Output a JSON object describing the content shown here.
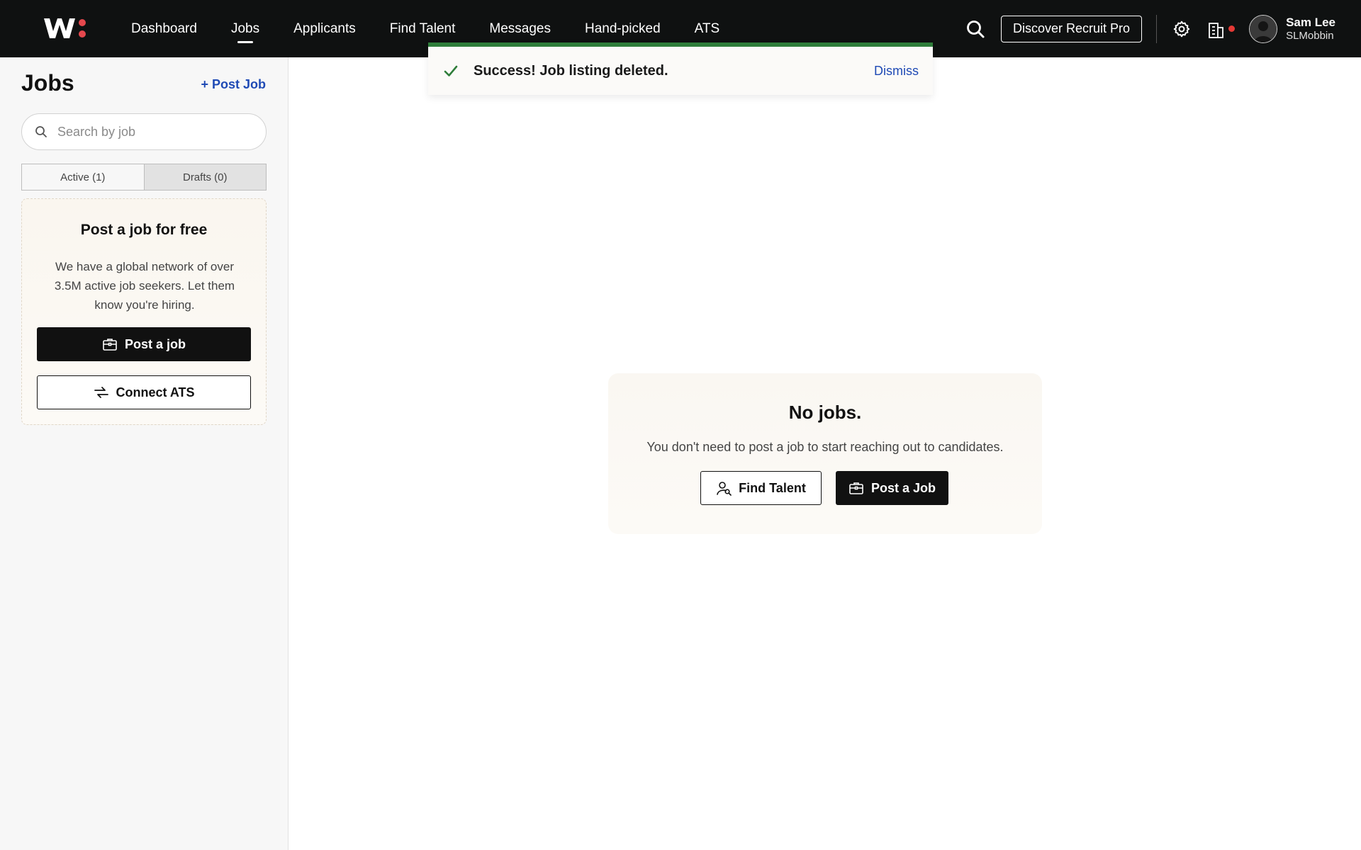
{
  "topbar": {
    "nav": [
      {
        "label": "Dashboard"
      },
      {
        "label": "Jobs",
        "active": true
      },
      {
        "label": "Applicants"
      },
      {
        "label": "Find Talent"
      },
      {
        "label": "Messages"
      },
      {
        "label": "Hand-picked"
      },
      {
        "label": "ATS"
      }
    ],
    "pro_button": "Discover Recruit Pro",
    "user": {
      "name": "Sam Lee",
      "handle": "SLMobbin"
    },
    "notification_color": "#e53935"
  },
  "toast": {
    "message": "Success! Job listing deleted.",
    "dismiss": "Dismiss",
    "accent_color": "#2e7d3a"
  },
  "sidebar": {
    "title": "Jobs",
    "post_link": "+ Post Job",
    "search": {
      "placeholder": "Search by job",
      "value": ""
    },
    "tabs": [
      {
        "label": "Active (1)",
        "selected": true
      },
      {
        "label": "Drafts (0)",
        "selected": false
      }
    ],
    "promo": {
      "title": "Post a job for free",
      "text": "We have a global network of over 3.5M active job seekers. Let them know you're hiring.",
      "primary_button": "Post a job",
      "secondary_button": "Connect ATS"
    }
  },
  "empty_state": {
    "title": "No jobs.",
    "text": "You don't need to post a job to start reaching out to candidates.",
    "find_talent_button": "Find Talent",
    "post_job_button": "Post a Job"
  },
  "icons": [
    "logo",
    "search-icon",
    "gear-icon",
    "company-icon",
    "avatar",
    "check-icon",
    "briefcase-icon",
    "connect-icon",
    "find-person-icon"
  ],
  "colors": {
    "link": "#1f4ab5",
    "topbar": "#0f1111",
    "logo_dot": "#e5484d"
  }
}
